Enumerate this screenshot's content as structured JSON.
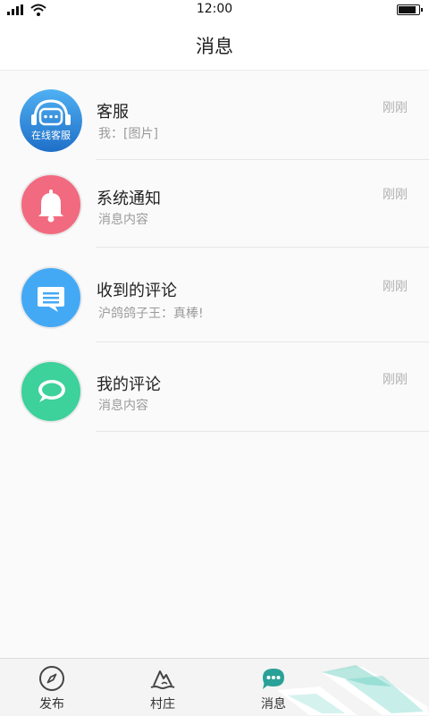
{
  "status_bar": {
    "time": "12:00"
  },
  "header": {
    "title": "消息"
  },
  "messages": [
    {
      "title": "客服",
      "subtitle": "我：[图片]",
      "time": "刚刚",
      "avatar_text": "在线客服",
      "icon": "headset-chat-icon",
      "color": "#2f8fe0"
    },
    {
      "title": "系统通知",
      "subtitle": "消息内容",
      "time": "刚刚",
      "icon": "bell-icon",
      "color": "#f26a7f"
    },
    {
      "title": "收到的评论",
      "subtitle": "沪鸽鸽子王：真棒!",
      "time": "刚刚",
      "icon": "comment-icon",
      "color": "#44a9f5"
    },
    {
      "title": "我的评论",
      "subtitle": "消息内容",
      "time": "刚刚",
      "icon": "chat-bubble-icon",
      "color": "#3dd19b"
    }
  ],
  "tabs": [
    {
      "label": "发布",
      "icon": "compass-icon"
    },
    {
      "label": "村庄",
      "icon": "mountain-icon"
    },
    {
      "label": "消息",
      "icon": "chat-icon",
      "active": true
    }
  ]
}
